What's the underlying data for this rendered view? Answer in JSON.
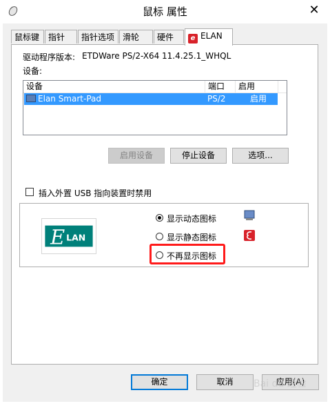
{
  "window": {
    "title": "鼠标 属性",
    "close_glyph": "✕"
  },
  "tabs": [
    {
      "label": "鼠标键"
    },
    {
      "label": "指针"
    },
    {
      "label": "指针选项"
    },
    {
      "label": "滑轮"
    },
    {
      "label": "硬件"
    },
    {
      "label": "ELAN",
      "active": true
    }
  ],
  "driver": {
    "label": "驱动程序版本:",
    "value": "ETDWare PS/2-X64 11.4.25.1_WHQL"
  },
  "devices": {
    "label": "设备:",
    "columns": [
      "设备",
      "端口",
      "启用"
    ],
    "rows": [
      {
        "device": "Elan Smart-Pad",
        "port": "PS/2",
        "enabled": "启用",
        "selected": true
      }
    ]
  },
  "device_buttons": {
    "enable": "启用设备",
    "stop": "停止设备",
    "options": "选项..."
  },
  "checkbox": {
    "label": "插入外置 USB 指向装置时禁用",
    "checked": false
  },
  "icon_group": {
    "options": [
      {
        "label": "显示动态图标",
        "checked": true
      },
      {
        "label": "显示静态图标",
        "checked": false
      },
      {
        "label": "不再显示图标",
        "checked": false
      }
    ],
    "logo_text": "LAN",
    "logo_letter": "E",
    "highlight_color": "#ff1a1a"
  },
  "footer_buttons": {
    "ok": "确定",
    "cancel": "取消",
    "apply": "应用(A)"
  },
  "watermark": "Bai du 经验",
  "colors": {
    "selection": "#3399ff",
    "elan_red": "#d8222a",
    "elan_teal": "#00807a"
  }
}
